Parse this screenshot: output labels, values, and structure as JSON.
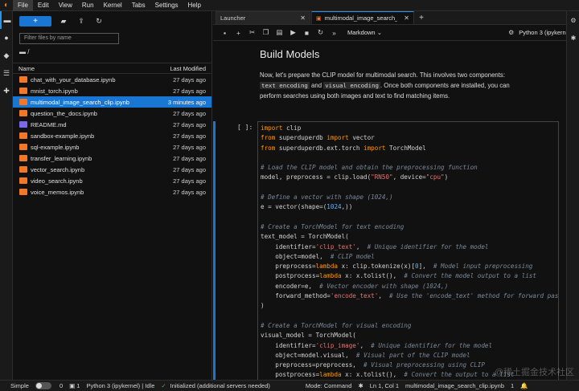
{
  "menu": [
    "File",
    "Edit",
    "View",
    "Run",
    "Kernel",
    "Tabs",
    "Settings",
    "Help"
  ],
  "file_browser": {
    "new_label": "+",
    "filter_placeholder": "Filter files by name",
    "path": "/",
    "col_name": "Name",
    "col_modified": "Last Modified",
    "files": [
      {
        "name": "chat_with_your_database.ipynb",
        "modified": "27 days ago",
        "type": "notebook"
      },
      {
        "name": "mnist_torch.ipynb",
        "modified": "27 days ago",
        "type": "notebook"
      },
      {
        "name": "multimodal_image_search_clip.ipynb",
        "modified": "3 minutes ago",
        "type": "notebook",
        "selected": true
      },
      {
        "name": "question_the_docs.ipynb",
        "modified": "27 days ago",
        "type": "notebook"
      },
      {
        "name": "README.md",
        "modified": "27 days ago",
        "type": "markdown"
      },
      {
        "name": "sandbox-example.ipynb",
        "modified": "27 days ago",
        "type": "notebook"
      },
      {
        "name": "sql-example.ipynb",
        "modified": "27 days ago",
        "type": "notebook"
      },
      {
        "name": "transfer_learning.ipynb",
        "modified": "27 days ago",
        "type": "notebook"
      },
      {
        "name": "vector_search.ipynb",
        "modified": "27 days ago",
        "type": "notebook"
      },
      {
        "name": "video_search.ipynb",
        "modified": "27 days ago",
        "type": "notebook"
      },
      {
        "name": "voice_memos.ipynb",
        "modified": "27 days ago",
        "type": "notebook"
      }
    ]
  },
  "tabs": [
    {
      "label": "Launcher",
      "active": false
    },
    {
      "label": "multimodal_image_search_",
      "active": true
    }
  ],
  "notebook_toolbar": {
    "cell_type": "Markdown",
    "kernel": "Python 3 (ipykernel)"
  },
  "markdown_cell": {
    "title": "Build Models",
    "para_1": "Now, let's prepare the CLIP model for multimodal search. This involves two components:",
    "code_1": "text encoding",
    "and": "and",
    "code_2": "visual encoding",
    "para_2": ". Once both components are installed, you can",
    "para_3": "perform searches using both images and text to find matching items."
  },
  "code_cell": {
    "prompt": "[ ]:"
  },
  "status_bar": {
    "mode": "Simple",
    "count_a": "0",
    "count_b": "1",
    "kernel_status": "Python 3 (ipykernel) | Idle",
    "init_status": "Initialized (additional servers needed)",
    "command_mode": "Mode: Command",
    "position": "Ln 1, Col 1",
    "filename": "multimodal_image_search_clip.ipynb",
    "tab_count": "1"
  },
  "watermark": "@稀土掘金技术社区"
}
